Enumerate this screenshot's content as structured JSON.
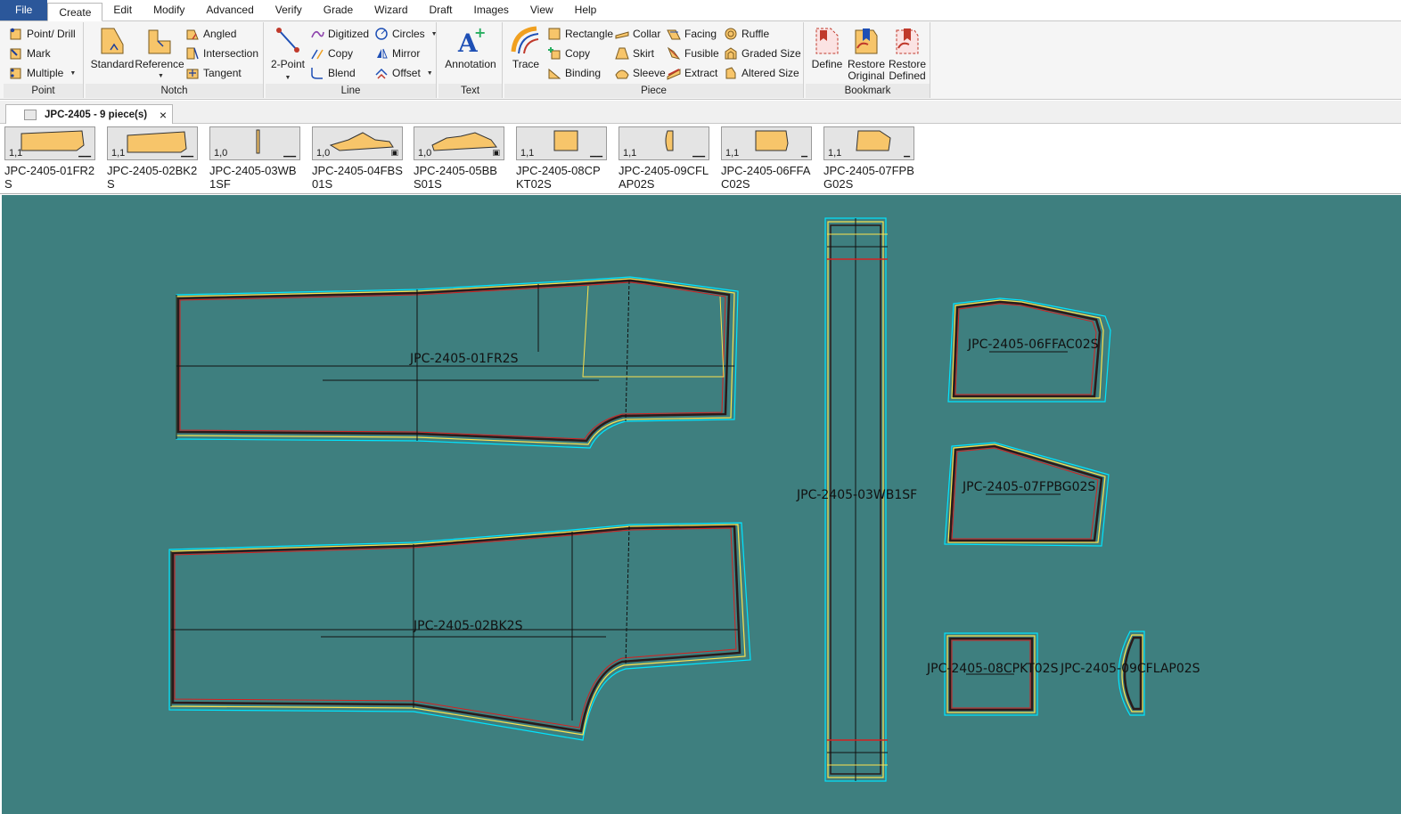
{
  "menu": {
    "items": [
      "File",
      "Create",
      "Edit",
      "Modify",
      "Advanced",
      "Verify",
      "Grade",
      "Wizard",
      "Draft",
      "Images",
      "View",
      "Help"
    ],
    "active": "Create"
  },
  "ribbon": {
    "point": {
      "label": "Point",
      "point_drill": "Point/ Drill",
      "mark": "Mark",
      "multiple": "Multiple"
    },
    "notch": {
      "label": "Notch",
      "standard": "Standard",
      "reference": "Reference",
      "angled": "Angled",
      "intersection": "Intersection",
      "tangent": "Tangent"
    },
    "line": {
      "label": "Line",
      "two_point": "2-Point",
      "digitized": "Digitized",
      "copy": "Copy",
      "blend": "Blend",
      "circles": "Circles",
      "mirror": "Mirror",
      "offset": "Offset"
    },
    "text": {
      "label": "Text",
      "annotation": "Annotation"
    },
    "piece": {
      "label": "Piece",
      "trace": "Trace",
      "rectangle": "Rectangle",
      "copy": "Copy",
      "binding": "Binding",
      "collar": "Collar",
      "skirt": "Skirt",
      "sleeve": "Sleeve",
      "facing": "Facing",
      "fusible": "Fusible",
      "extract": "Extract",
      "ruffle": "Ruffle",
      "graded_size": "Graded Size",
      "altered_size": "Altered Size"
    },
    "bookmark": {
      "label": "Bookmark",
      "define": "Define",
      "restore_original_1": "Restore",
      "restore_original_2": "Original",
      "restore_defined_1": "Restore",
      "restore_defined_2": "Defined"
    }
  },
  "tab": {
    "title": "JPC-2405  -  9 piece(s)",
    "close": "×"
  },
  "pieces": [
    {
      "size": "1,1",
      "name": "JPC-2405-01FR2S"
    },
    {
      "size": "1,1",
      "name": "JPC-2405-02BK2S"
    },
    {
      "size": "1,0",
      "name": "JPC-2405-03WB1SF"
    },
    {
      "size": "1,0",
      "name": "JPC-2405-04FBS01S"
    },
    {
      "size": "1,0",
      "name": "JPC-2405-05BBS01S"
    },
    {
      "size": "1,1",
      "name": "JPC-2405-08CPKT02S"
    },
    {
      "size": "1,1",
      "name": "JPC-2405-09CFLAP02S"
    },
    {
      "size": "1,1",
      "name": "JPC-2405-06FFAC02S"
    },
    {
      "size": "1,1",
      "name": "JPC-2405-07FPBG02S"
    }
  ],
  "canvas": {
    "labels": {
      "front": "JPC-2405-01FR2S",
      "back": "JPC-2405-02BK2S",
      "waistband": "JPC-2405-03WB1SF",
      "facing": "JPC-2405-06FFAC02S",
      "pocket_bag": "JPC-2405-07FPBG02S",
      "cargo_pocket": "JPC-2405-08CPKT02S",
      "cargo_flap": "JPC-2405-09CFLAP02S"
    }
  }
}
